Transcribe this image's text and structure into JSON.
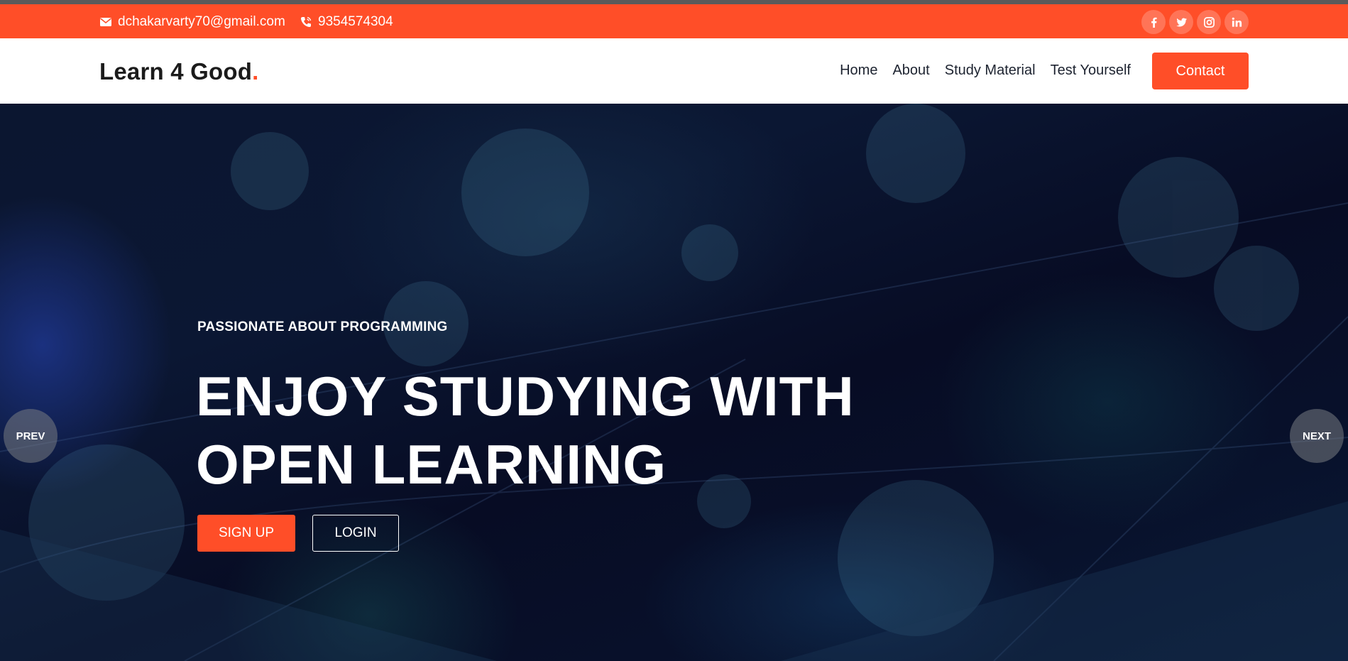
{
  "topbar": {
    "email": "dchakarvarty70@gmail.com",
    "phone": "9354574304",
    "socials": [
      {
        "name": "facebook-icon"
      },
      {
        "name": "twitter-icon"
      },
      {
        "name": "instagram-icon"
      },
      {
        "name": "linkedin-icon"
      }
    ]
  },
  "navbar": {
    "brand": "Learn 4 Good",
    "brand_dot": ".",
    "menu": [
      "Home",
      "About",
      "Study Material",
      "Test Yourself"
    ],
    "contact_label": "Contact"
  },
  "hero": {
    "eyebrow": "PASSIONATE ABOUT PROGRAMMING",
    "headline_line1": "ENJOY STUDYING WITH",
    "headline_line2": "OPEN LEARNING",
    "signup_label": "SIGN UP",
    "login_label": "LOGIN",
    "prev_label": "PREV",
    "next_label": "NEXT"
  },
  "colors": {
    "accent": "#ff4e28",
    "hero_dark": "#070c24",
    "text_dark": "#1b1b1b"
  }
}
